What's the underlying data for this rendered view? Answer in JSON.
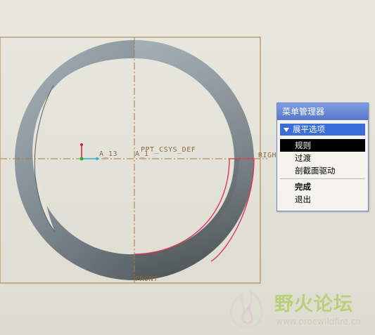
{
  "viewport": {
    "datum_labels": {
      "a13": "A_13",
      "a1": "A_1",
      "csys": "PPT_CSYS_DEF",
      "right": "RIGHT",
      "front": "FRONT"
    }
  },
  "menu_manager": {
    "title": "菜单管理器",
    "section": "展平选项",
    "items": [
      {
        "label": "规则",
        "selected": true
      },
      {
        "label": "过渡",
        "selected": false
      },
      {
        "label": "剖截面驱动",
        "selected": false
      }
    ],
    "actions": [
      {
        "label": "完成"
      },
      {
        "label": "退出"
      }
    ]
  },
  "watermark": {
    "title": "野火论坛",
    "url": "www.proewildfire.cn"
  },
  "colors": {
    "datum": "#a57a48",
    "highlight": "#e0335a",
    "menu_accent": "#3b6fd8"
  }
}
